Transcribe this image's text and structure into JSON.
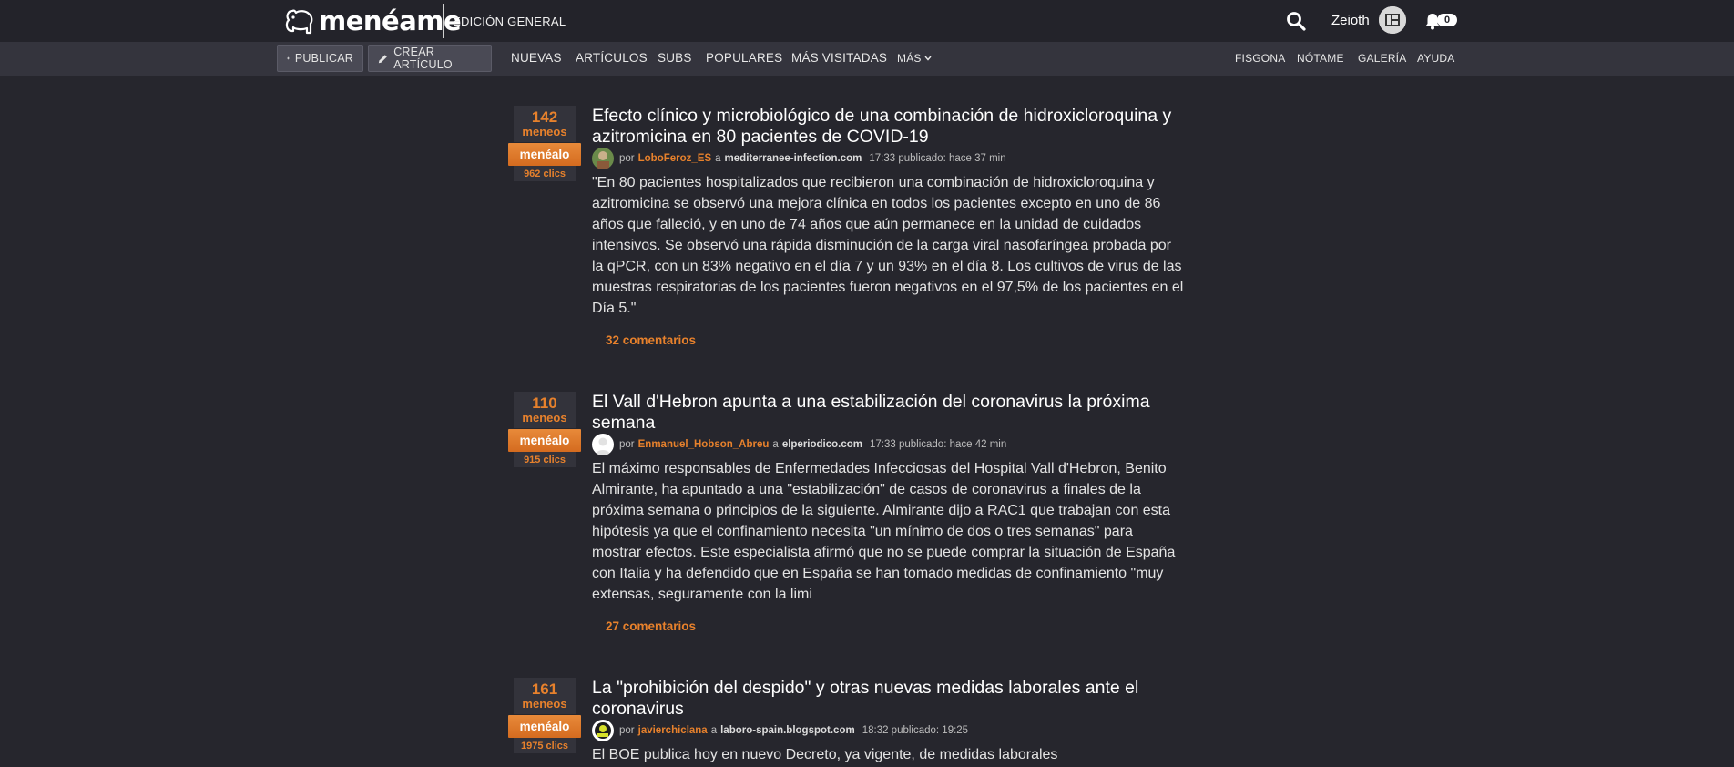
{
  "header": {
    "logo_text": "menéame",
    "edition": "EDICIÓN GENERAL",
    "username": "Zeioth",
    "notifications": "0"
  },
  "nav": {
    "publicar": "PUBLICAR",
    "crear_articulo": "CREAR ARTÍCULO",
    "items": [
      "NUEVAS",
      "ARTÍCULOS",
      "SUBS",
      "POPULARES",
      "MÁS VISITADAS",
      "MÁS"
    ],
    "right_items": [
      "FISGONA",
      "NÓTAME",
      "GALERÍA",
      "AYUDA"
    ]
  },
  "stories": [
    {
      "votes": "142",
      "votes_unit": "meneos",
      "button": "menéalo",
      "clicks": "962 clics",
      "title": "Efecto clínico y microbiológico de una combinación de hidroxicloroquina y azitromicina en 80 pacientes de COVID-19",
      "by": "por",
      "author": "LoboFeroz_ES",
      "to": "a",
      "domain": "mediterranee-infection.com",
      "time": "17:33 publicado: hace 37 min",
      "body": "\"En 80 pacientes hospitalizados que recibieron una combinación de hidroxicloroquina y azitromicina se observó una mejora clínica en todos los pacientes excepto en uno de 86 años que falleció, y en uno de 74 años que aún permanece en la unidad de cuidados intensivos. Se observó una rápida disminución de la carga viral nasofaríngea probada por la qPCR, con un 83% negativo en el día 7 y un 93% en el día 8. Los cultivos de virus de las muestras respiratorias de los pacientes fueron negativos en el 97,5% de los pacientes en el Día 5.\"",
      "comments": "32 comentarios"
    },
    {
      "votes": "110",
      "votes_unit": "meneos",
      "button": "menéalo",
      "clicks": "915 clics",
      "title": "El Vall d'Hebron apunta a una estabilización del coronavirus la próxima semana",
      "by": "por",
      "author": "Enmanuel_Hobson_Abreu",
      "to": "a",
      "domain": "elperiodico.com",
      "time": "17:33 publicado: hace 42 min",
      "body": "El máximo responsables de Enfermedades Infecciosas del Hospital Vall d'Hebron, Benito Almirante, ha apuntado a una \"estabilización\" de casos de coronavirus a finales de la próxima semana o principios de la siguiente. Almirante dijo a RAC1 que trabajan con esta hipótesis ya que el confinamiento necesita \"un mínimo de dos o tres semanas\" para mostrar efectos. Este especialista afirmó que no se puede comprar la situación de España con Italia y ha defendido que en España se han tomado medidas de confinamiento \"muy extensas, seguramente con la limi",
      "comments": "27 comentarios"
    },
    {
      "votes": "161",
      "votes_unit": "meneos",
      "button": "menéalo",
      "clicks": "1975 clics",
      "title": "La \"prohibición del despido\" y otras nuevas medidas laborales ante el coronavirus",
      "by": "por",
      "author": "javierchiclana",
      "to": "a",
      "domain": "laboro-spain.blogspot.com",
      "time": "18:32 publicado: 19:25",
      "body": "El BOE publica hoy en nuevo Decreto, ya vigente, de medidas laborales",
      "comments": ""
    }
  ],
  "colors": {
    "accent": "#e7812c",
    "background": "#26262d",
    "topbar": "#23232a",
    "navbar": "#34343d"
  }
}
